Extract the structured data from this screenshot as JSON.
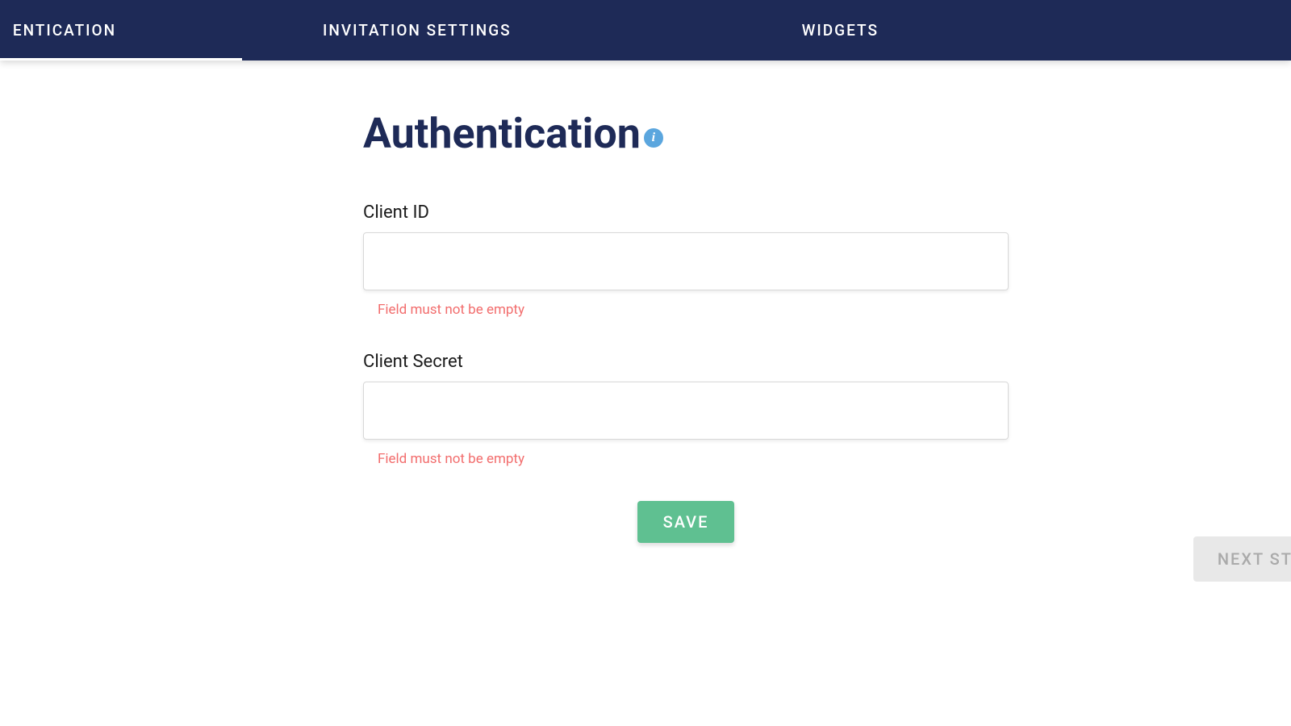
{
  "tabs": {
    "authentication": "ENTICATION",
    "invitation": "INVITATION SETTINGS",
    "widgets": "WIDGETS"
  },
  "page": {
    "title": "Authentication"
  },
  "form": {
    "clientId": {
      "label": "Client ID",
      "value": "",
      "error": "Field must not be empty"
    },
    "clientSecret": {
      "label": "Client Secret",
      "value": "",
      "error": "Field must not be empty"
    }
  },
  "buttons": {
    "save": "SAVE",
    "nextStep": "NEXT STEP"
  },
  "colors": {
    "navy": "#1e2a57",
    "green": "#5fc091",
    "blue": "#5ba6de",
    "error": "#f26d6d"
  }
}
